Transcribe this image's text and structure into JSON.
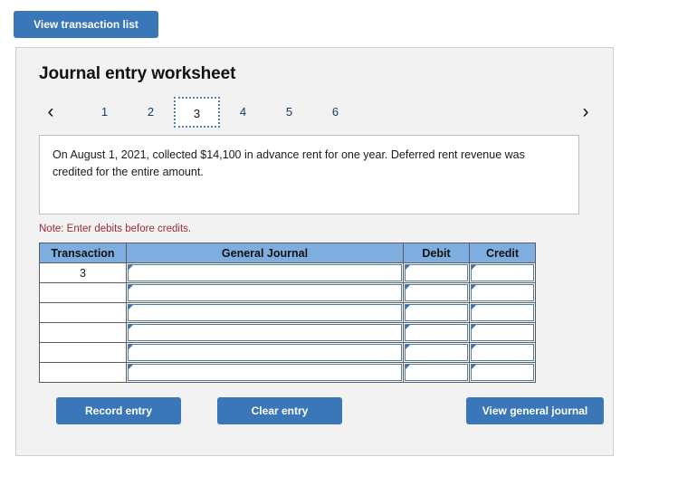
{
  "top": {
    "view_transaction_list_label": "View transaction list"
  },
  "panel": {
    "title": "Journal entry worksheet",
    "pager": {
      "prev_icon": "chevron-left-icon",
      "next_icon": "chevron-right-icon",
      "prev_glyph": "‹",
      "next_glyph": "›",
      "items": [
        "1",
        "2",
        "3",
        "4",
        "5",
        "6"
      ],
      "active_index": 2
    },
    "description": "On August 1, 2021, collected $14,100 in advance rent for one year. Deferred rent revenue was credited for the entire amount.",
    "note": "Note: Enter debits before credits.",
    "table": {
      "headers": [
        "Transaction",
        "General Journal",
        "Debit",
        "Credit"
      ],
      "rows": [
        {
          "transaction": "3",
          "journal": "",
          "debit": "",
          "credit": ""
        },
        {
          "transaction": "",
          "journal": "",
          "debit": "",
          "credit": ""
        },
        {
          "transaction": "",
          "journal": "",
          "debit": "",
          "credit": ""
        },
        {
          "transaction": "",
          "journal": "",
          "debit": "",
          "credit": ""
        },
        {
          "transaction": "",
          "journal": "",
          "debit": "",
          "credit": ""
        },
        {
          "transaction": "",
          "journal": "",
          "debit": "",
          "credit": ""
        }
      ]
    },
    "footer": {
      "record_label": "Record entry",
      "clear_label": "Clear entry",
      "journal_label": "View general journal"
    }
  },
  "colors": {
    "button_blue": "#3a77b8",
    "table_header_blue": "#7eaddf",
    "input_border_blue": "#4e7dad",
    "note_red": "#9c2a3a",
    "panel_bg": "#f2f2f2"
  }
}
